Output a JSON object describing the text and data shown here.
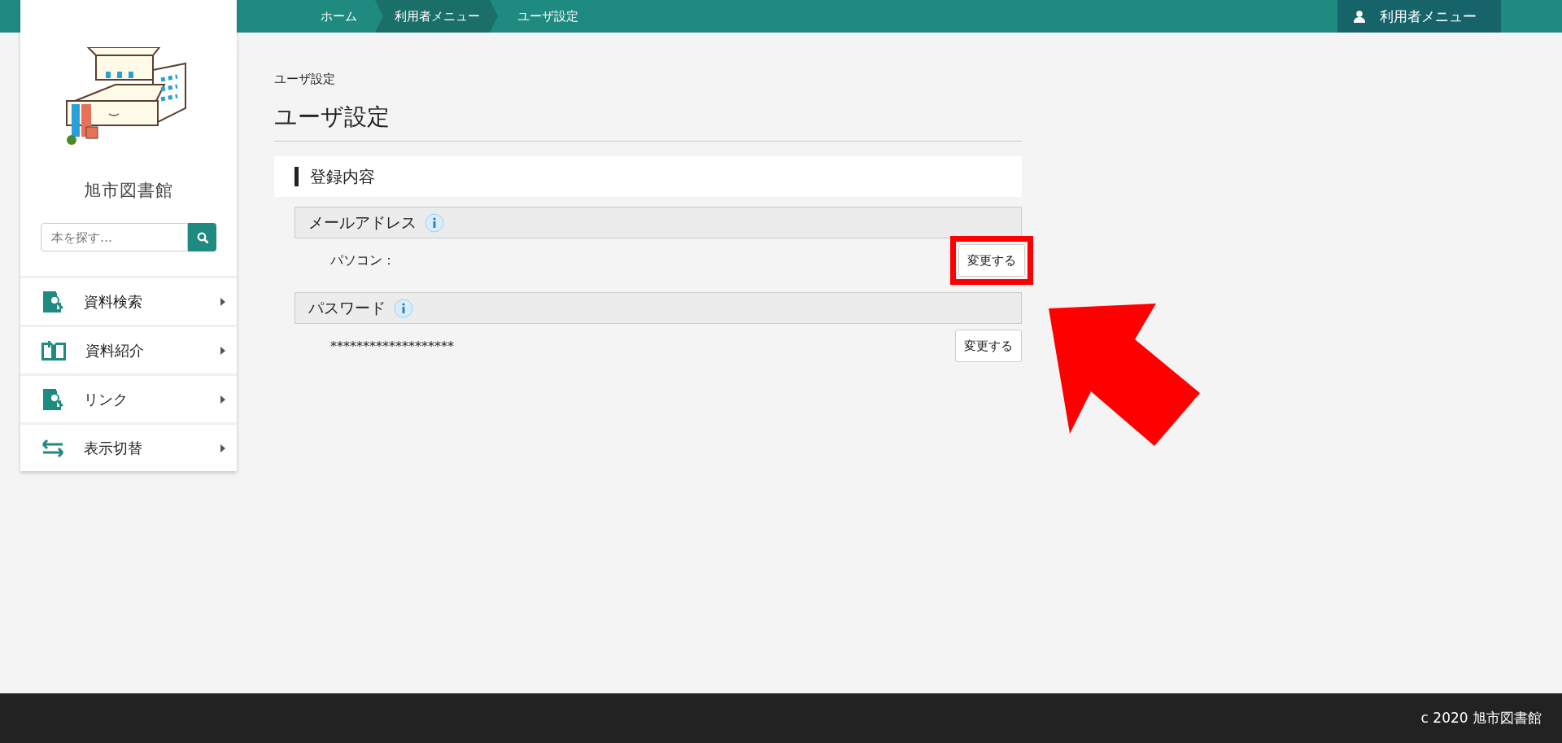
{
  "breadcrumbs": [
    {
      "label": "ホーム",
      "selected": false
    },
    {
      "label": "利用者メニュー",
      "selected": true
    },
    {
      "label": "ユーザ設定",
      "selected": false
    }
  ],
  "user_menu": {
    "label": "利用者メニュー"
  },
  "sidebar": {
    "library_name": "旭市図書館",
    "search": {
      "placeholder": "本を探す…"
    },
    "items": [
      {
        "kind": "search",
        "label": "資料検索"
      },
      {
        "kind": "book",
        "label": "資料紹介"
      },
      {
        "kind": "search",
        "label": "リンク"
      },
      {
        "kind": "swap",
        "label": "表示切替"
      }
    ]
  },
  "page": {
    "breadcrumb_title": "ユーザ設定",
    "title": "ユーザ設定",
    "section": "登録内容",
    "groups": [
      {
        "heading": "メールアドレス",
        "value": "パソコン：",
        "button": "変更する",
        "highlighted": true
      },
      {
        "heading": "パスワード",
        "value": "*******************",
        "button": "変更する",
        "highlighted": false
      }
    ]
  },
  "footer": {
    "copyright": "c 2020 旭市図書館"
  }
}
